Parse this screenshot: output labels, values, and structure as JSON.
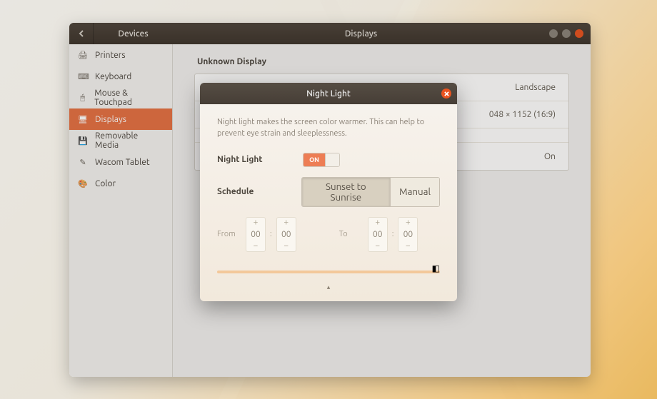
{
  "titlebar": {
    "side": "Devices",
    "main": "Displays"
  },
  "sidebar": {
    "items": [
      {
        "icon": "🖨",
        "label": "Printers"
      },
      {
        "icon": "⌨",
        "label": "Keyboard"
      },
      {
        "icon": "🖱",
        "label": "Mouse & Touchpad"
      },
      {
        "icon": "🖥",
        "label": "Displays"
      },
      {
        "icon": "💾",
        "label": "Removable Media"
      },
      {
        "icon": "✎",
        "label": "Wacom Tablet"
      },
      {
        "icon": "🎨",
        "label": "Color"
      }
    ]
  },
  "main": {
    "section": "Unknown Display",
    "rows": [
      {
        "value": "Landscape"
      },
      {
        "value": "048 × 1152 (16:9)"
      },
      {
        "value": "On"
      }
    ]
  },
  "dialog": {
    "title": "Night Light",
    "desc": "Night light makes the screen color warmer. This can help to prevent eye strain and sleeplessness.",
    "toggle_label": "Night Light",
    "toggle_state": "ON",
    "schedule_label": "Schedule",
    "seg_auto": "Sunset to Sunrise",
    "seg_manual": "Manual",
    "from_label": "From",
    "to_label": "To",
    "from_h": "00",
    "from_m": "00",
    "to_h": "00",
    "to_m": "00"
  }
}
